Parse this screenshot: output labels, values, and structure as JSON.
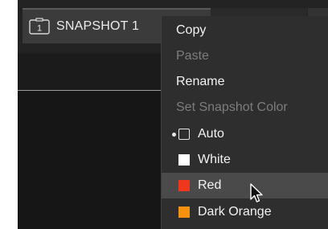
{
  "snapshot_tab": {
    "icon": "snapshot-frame-icon",
    "icon_number": "1",
    "label": "SNAPSHOT 1"
  },
  "context_menu": {
    "copy": "Copy",
    "paste": "Paste",
    "rename": "Rename",
    "set_color_header": "Set Snapshot Color",
    "colors": [
      {
        "label": "Auto",
        "swatch": "outline",
        "color": "#e6e6e6",
        "selected": true
      },
      {
        "label": "White",
        "swatch": "fill",
        "color": "#ffffff",
        "selected": false
      },
      {
        "label": "Red",
        "swatch": "fill",
        "color": "#f0361c",
        "selected": false,
        "highlighted": true
      },
      {
        "label": "Dark Orange",
        "swatch": "fill",
        "color": "#f5920f",
        "selected": false
      }
    ]
  },
  "cursor": {
    "icon": "arrow-pointer-icon"
  }
}
